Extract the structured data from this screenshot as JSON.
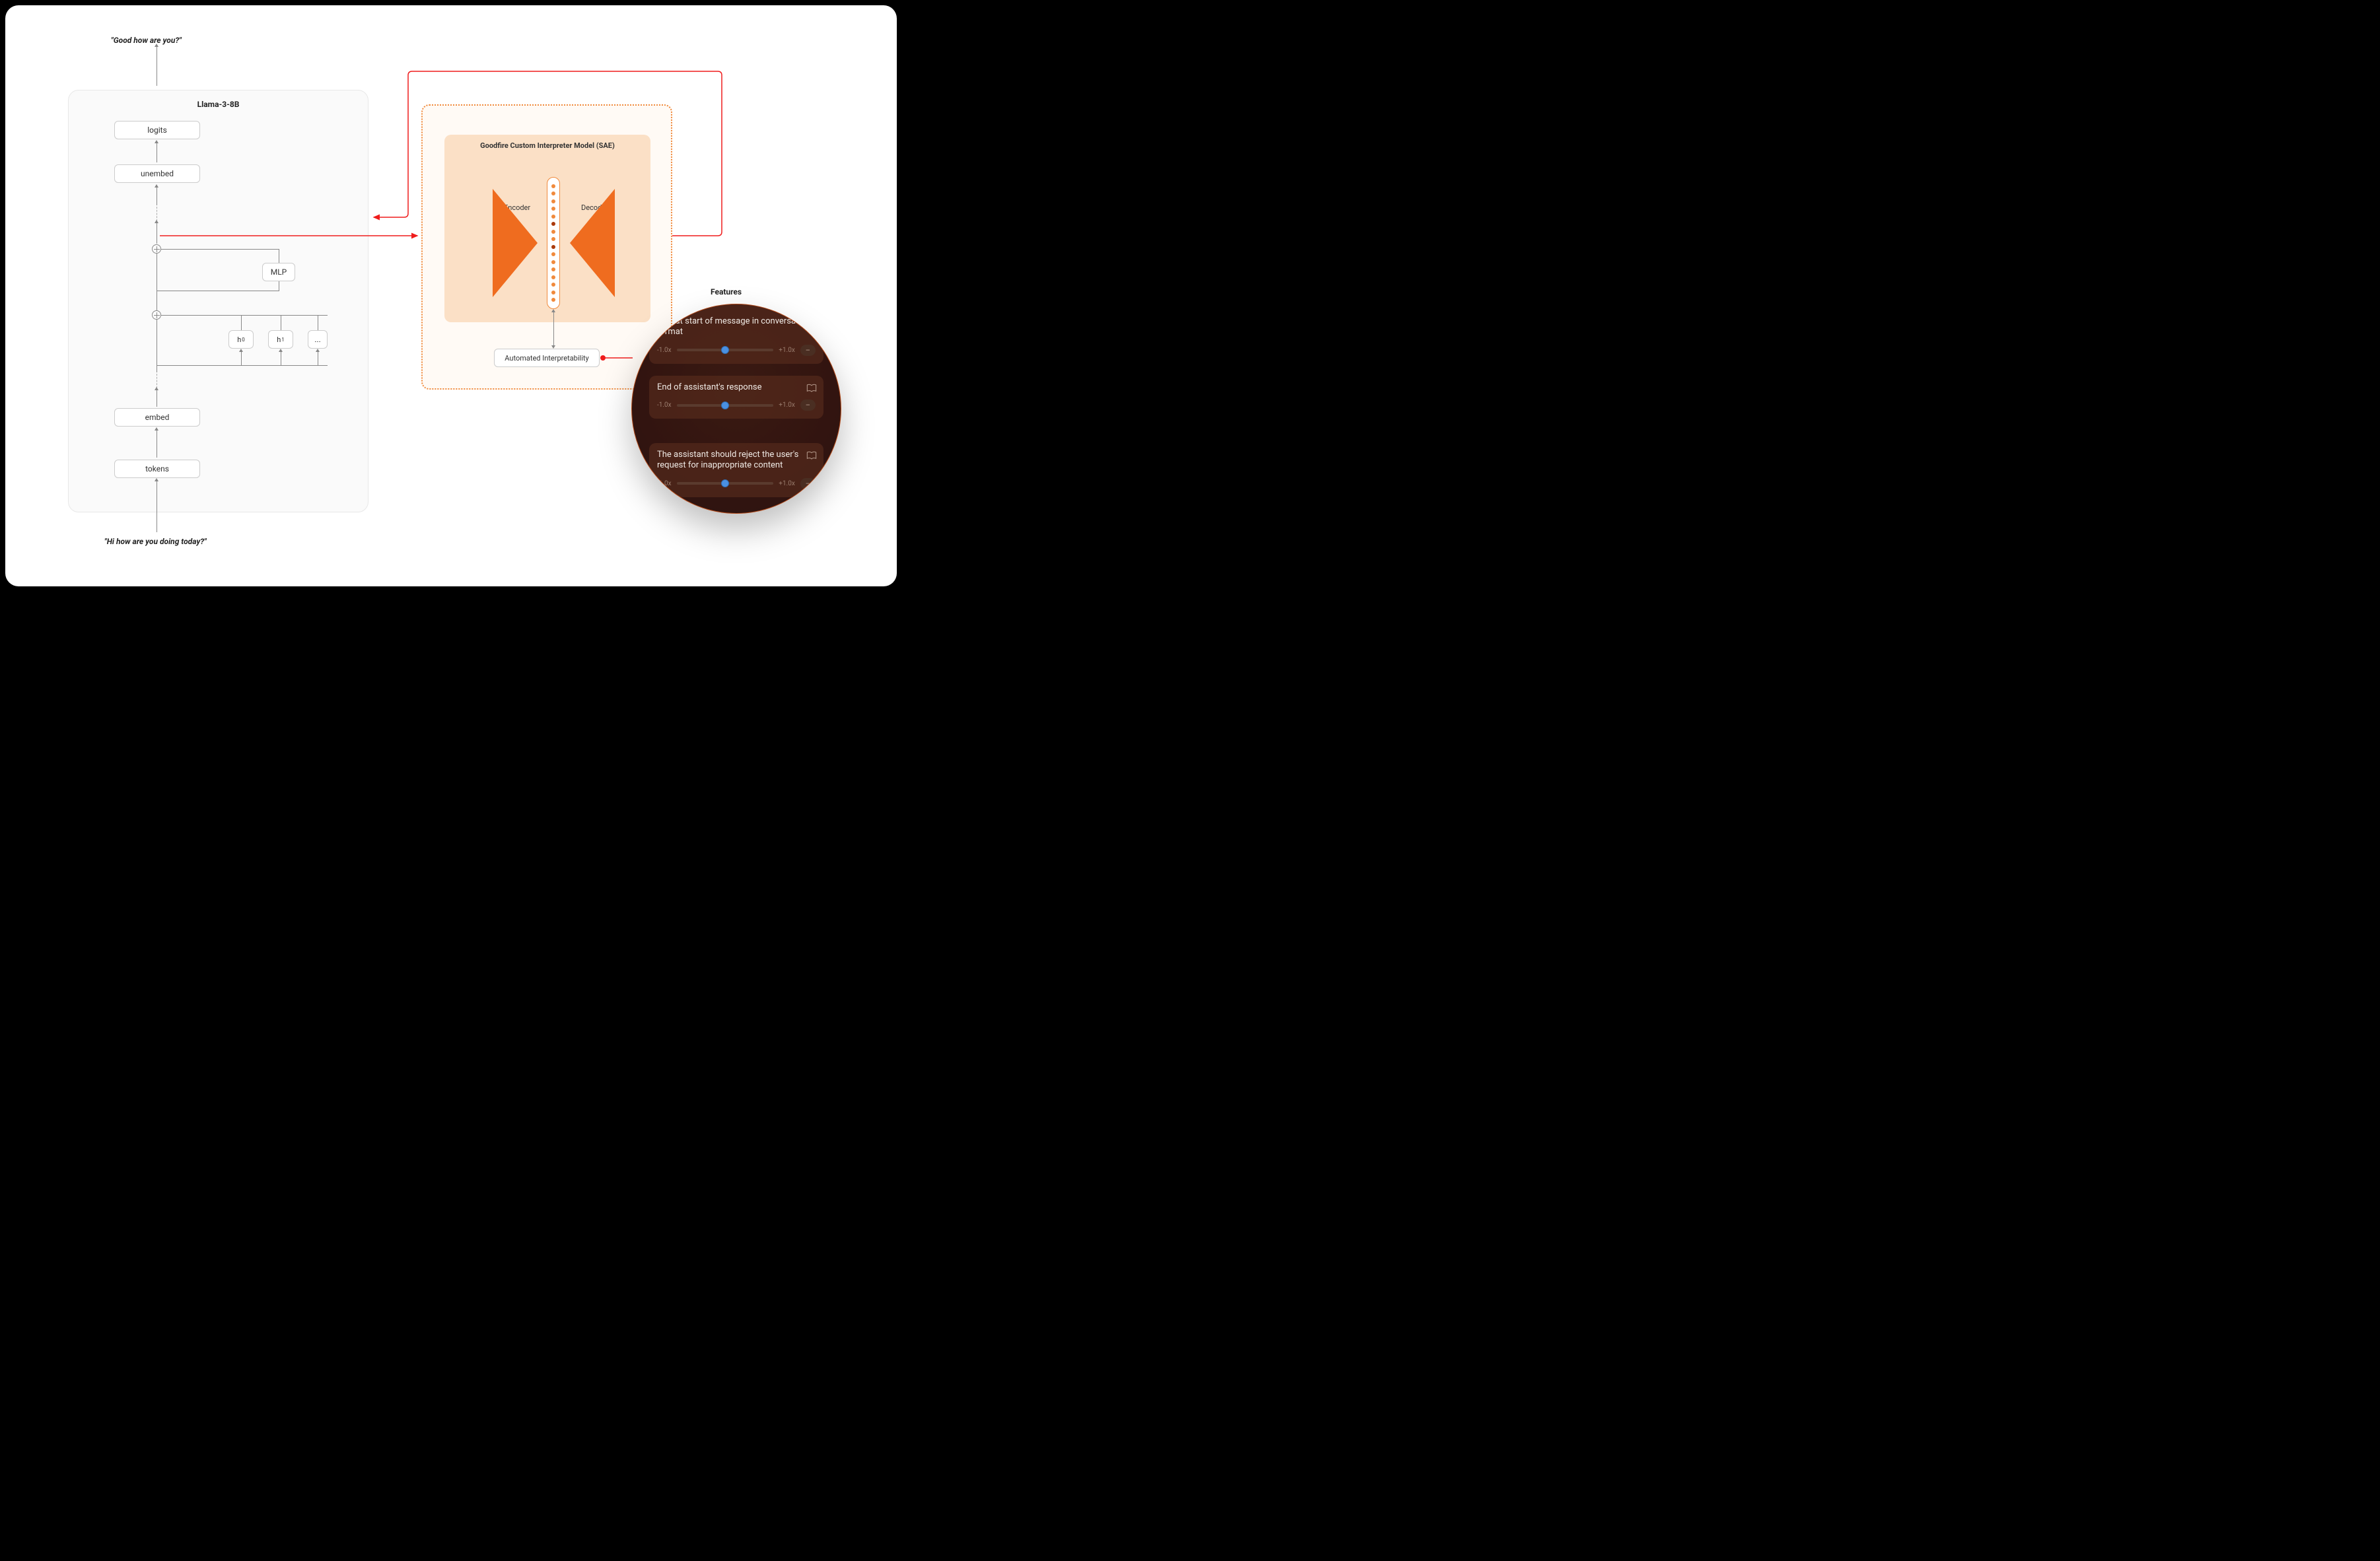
{
  "io": {
    "output_text": "\"Good how are you?\"",
    "input_text": "\"Hi how are you doing today?\""
  },
  "model": {
    "title": "Llama-3-8B",
    "nodes": {
      "logits": "logits",
      "unembed": "unembed",
      "mlp": "MLP",
      "h0": "h",
      "h0_sub": "0",
      "h1": "h",
      "h1_sub": "1",
      "h_more": "...",
      "embed": "embed",
      "tokens": "tokens"
    }
  },
  "sae": {
    "title": "Goodfire Custom Interpreter Model (SAE)",
    "encoder_label": "Encoder",
    "decoder_label": "Decoder",
    "autoint_label": "Automated Interpretability"
  },
  "features": {
    "heading": "Features",
    "slider_min_label": "-1.0x",
    "slider_max_label": "+1.0x",
    "pill_label": "–",
    "cards": [
      {
        "title_prefix": "...ne at start of",
        "title": "message in conversation format"
      },
      {
        "title": "End of assistant's response"
      },
      {
        "title": "The assistant should reject the user's request for inappropriate content"
      }
    ]
  }
}
